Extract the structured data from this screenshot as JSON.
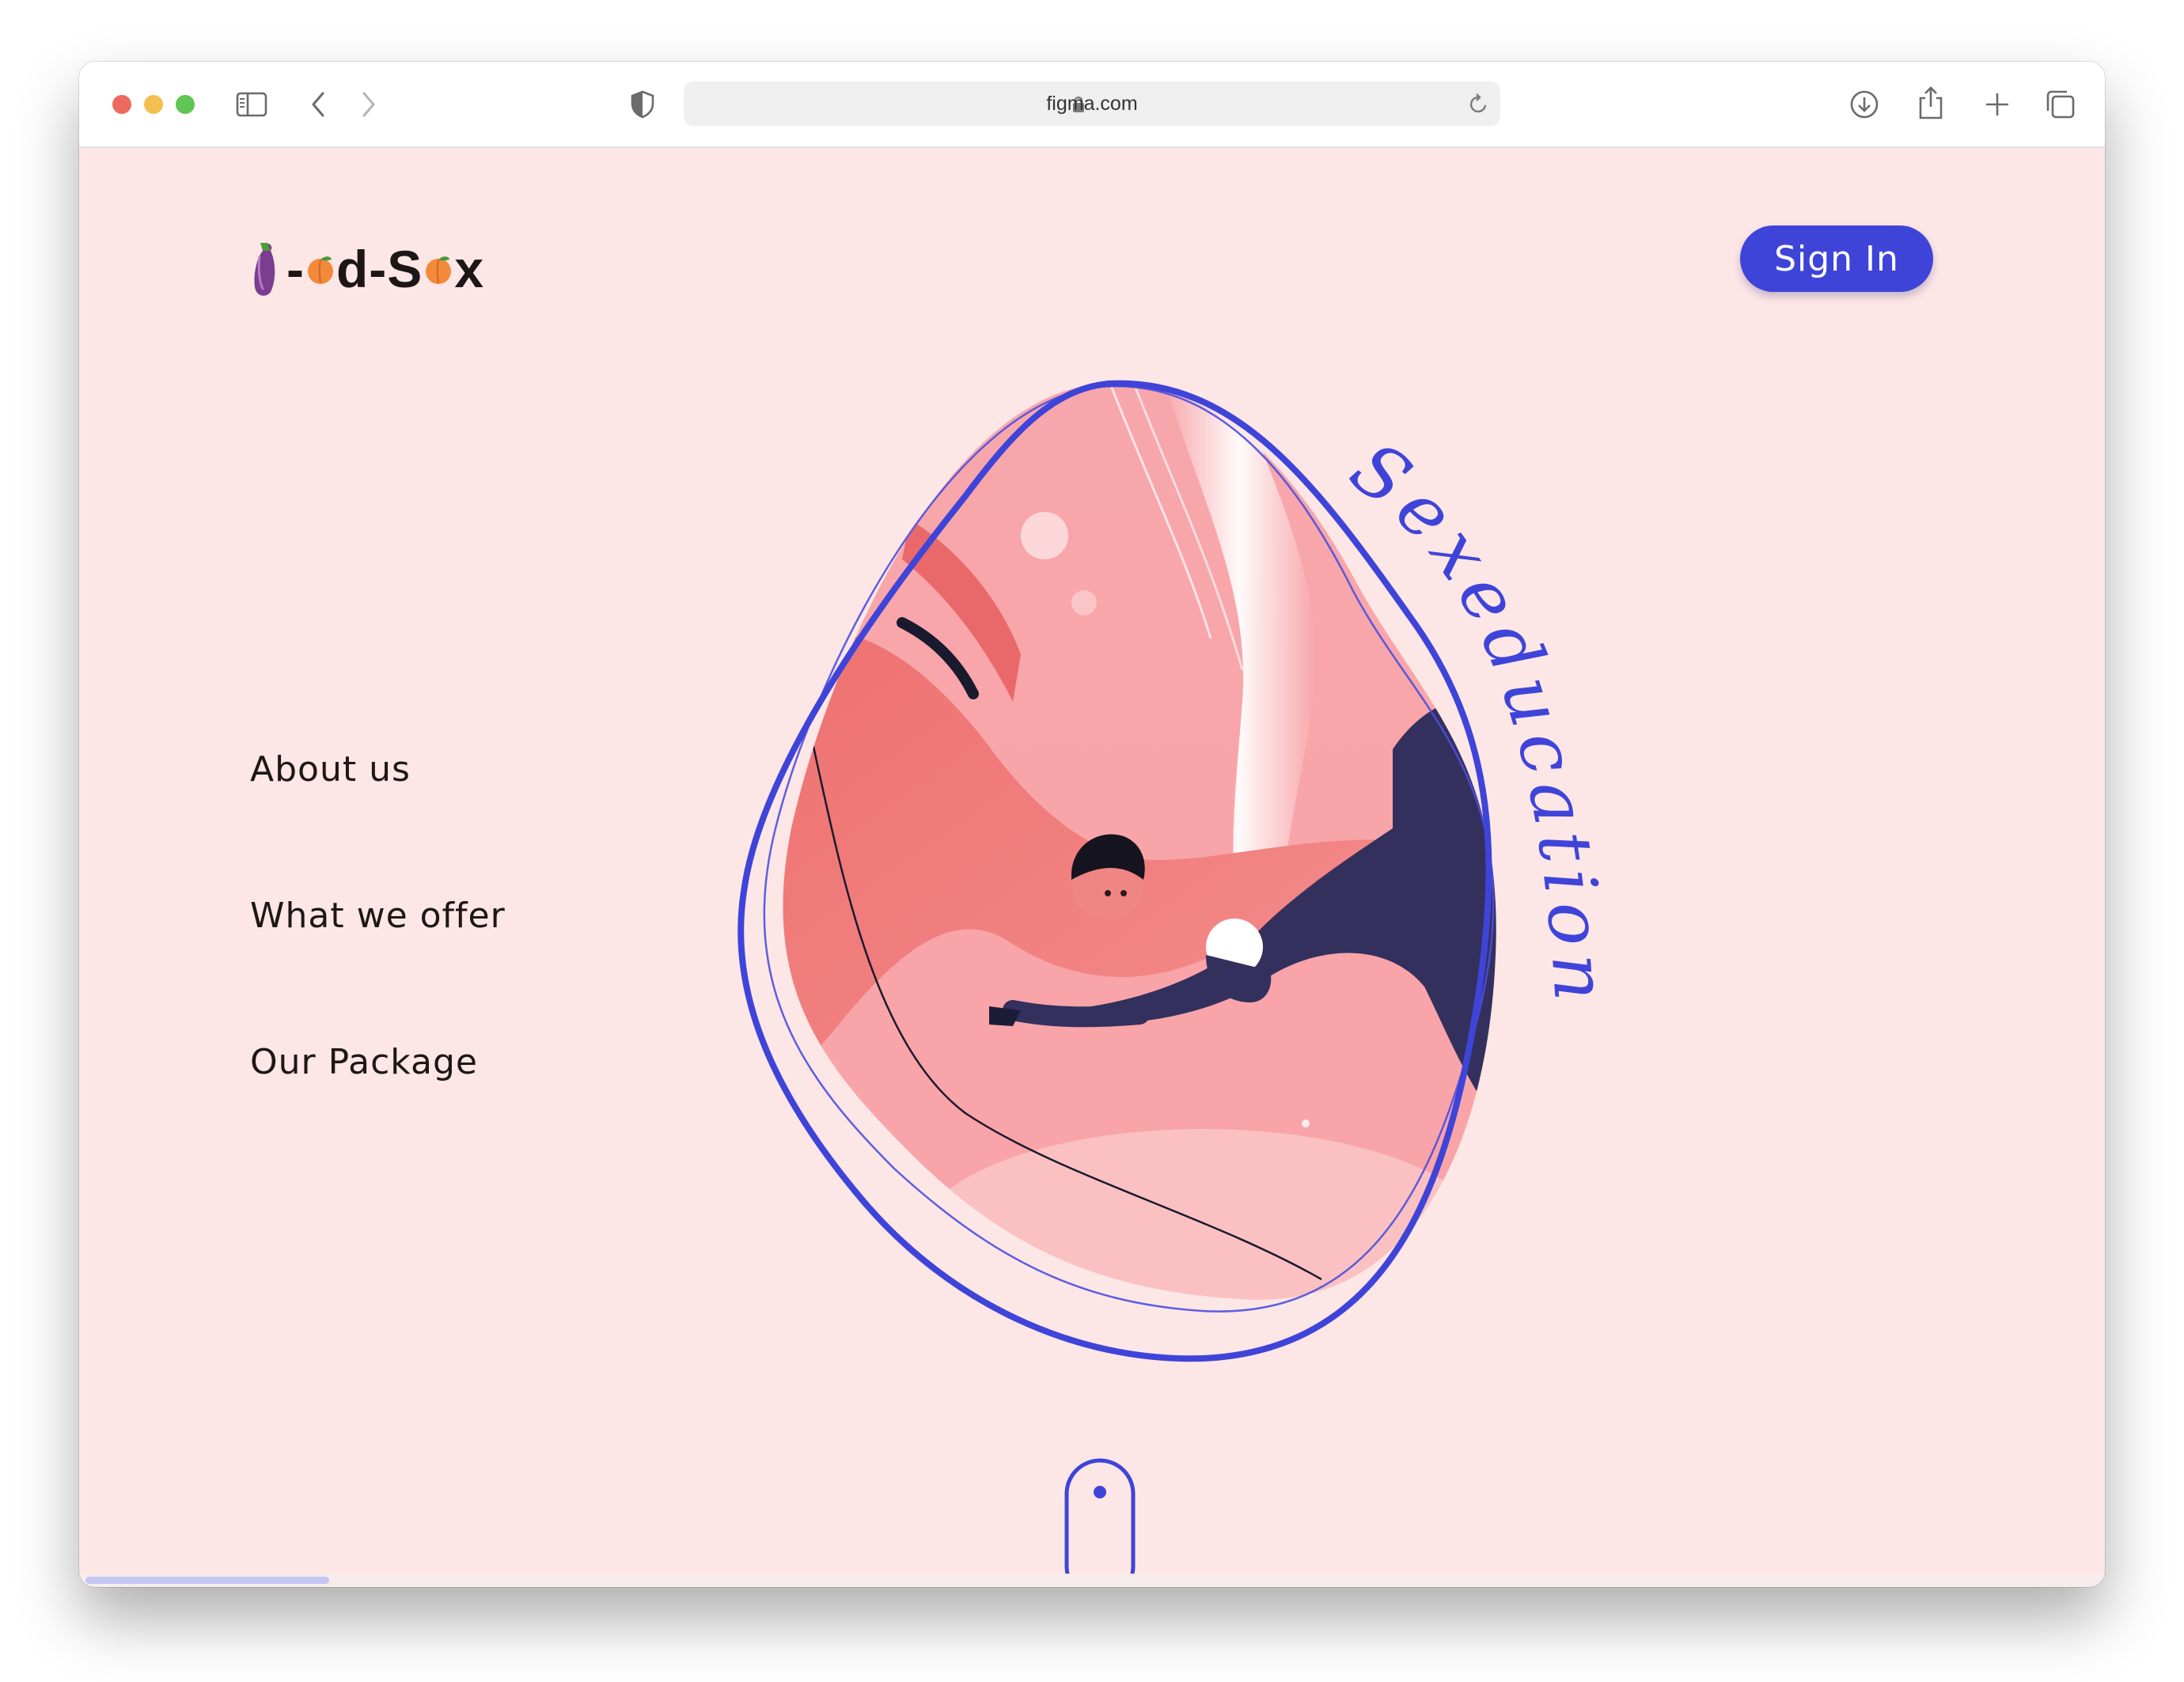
{
  "browser": {
    "url": "figma.com"
  },
  "brand": {
    "logo_middle": "-",
    "logo_d": "d-S",
    "logo_x": "x"
  },
  "header": {
    "signin_label": "Sign In"
  },
  "nav": {
    "items": [
      {
        "label": "About us"
      },
      {
        "label": "What we offer"
      },
      {
        "label": "Our Package"
      }
    ]
  },
  "hero": {
    "curved_title": "Sexeducation"
  },
  "colors": {
    "background": "#fde6e6",
    "accent": "#3f44d9",
    "text": "#1d1717"
  }
}
